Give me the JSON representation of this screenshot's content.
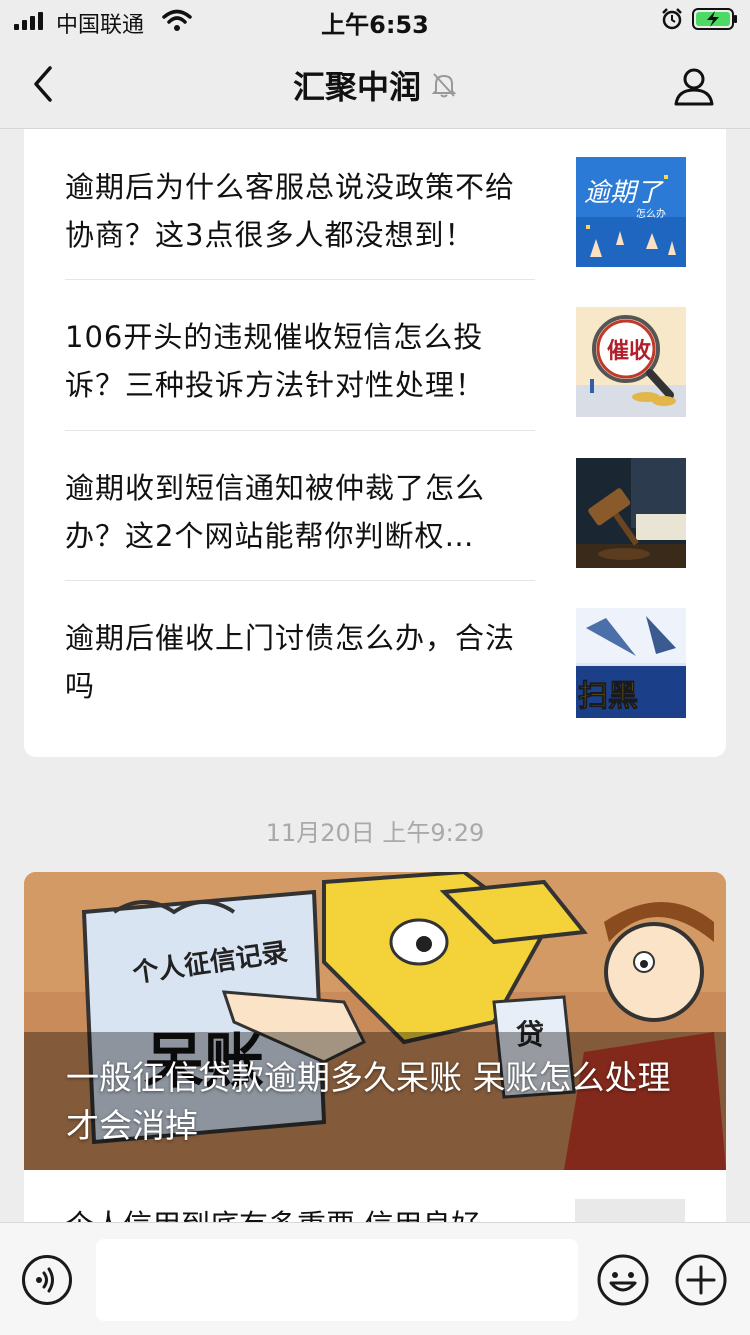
{
  "status_bar": {
    "carrier": "中国联通",
    "time": "上午6:53"
  },
  "nav": {
    "title": "汇聚中润",
    "muted": true
  },
  "articles": [
    {
      "title": "逾期后为什么客服总说没政策不给协商？这3点很多人都没想到！",
      "thumb_text": "逾期了",
      "thumb_subtext": "怎么办"
    },
    {
      "title": "106开头的违规催收短信怎么投诉？三种投诉方法针对性处理！",
      "thumb_text": "催收"
    },
    {
      "title": "逾期收到短信通知被仲裁了怎么办？这2个网站能帮你判断权…",
      "thumb_text": ""
    },
    {
      "title": "逾期后催收上门讨债怎么办，合法吗",
      "thumb_text": "扫黑"
    }
  ],
  "timestamp": "11月20日 上午9:29",
  "featured": {
    "title": "一般征信贷款逾期多久呆账 呆账怎么处理才会消掉",
    "image_text_record": "个人征信记录",
    "image_text_bad": "呆账",
    "image_text_loan": "贷"
  },
  "next_article": {
    "title": "个人信用到底有多重要 信用良好"
  },
  "input_bar": {
    "placeholder": ""
  }
}
